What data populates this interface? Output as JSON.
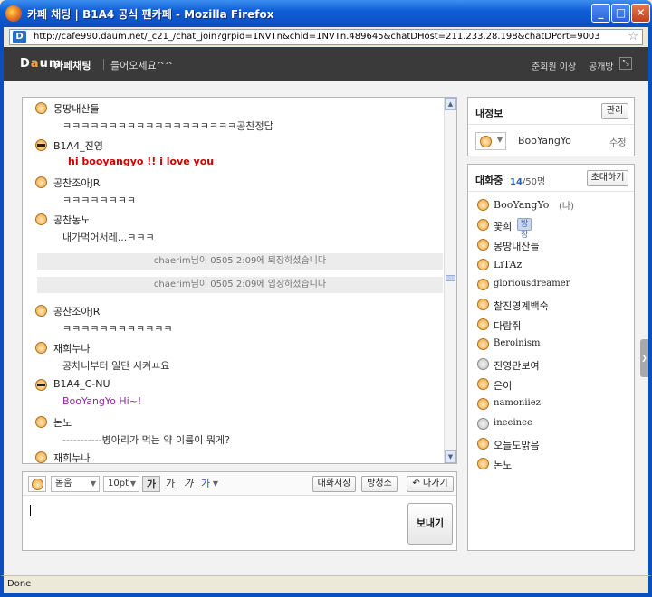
{
  "window": {
    "title": "카페 채팅 | B1A4 공식 팬카페 - Mozilla Firefox"
  },
  "address_bar": {
    "url": "http://cafe990.daum.net/_c21_/chat_join?grpid=1NVTn&chid=1NVTn.489645&chatDHost=211.233.28.198&chatDPort=9003"
  },
  "header": {
    "logo": "Daum",
    "service": "카페채팅",
    "welcome": "들어오세요^^",
    "level": "준회원 이상",
    "open_room": "공개방"
  },
  "chat": {
    "messages": [
      {
        "nick": "몽땅내산들",
        "text": "ㅋㅋㅋㅋㅋㅋㅋㅋㅋㅋㅋㅋㅋㅋㅋㅋㅋㅋㅋ공찬정답",
        "face": "normal",
        "color": "#333333"
      },
      {
        "nick": "B1A4_진영",
        "text": "hi booyangyo !! i love you",
        "face": "cool",
        "color": "#cc0000"
      },
      {
        "nick": "공찬조아JR",
        "text": "ㅋㅋㅋㅋㅋㅋㅋㅋ",
        "face": "normal",
        "color": "#333333"
      },
      {
        "nick": "공찬농노",
        "text": "내가먹어서레...ㅋㅋㅋ",
        "face": "normal",
        "color": "#333333"
      },
      {
        "nick": "공찬조아JR",
        "text": "ㅋㅋㅋㅋㅋㅋㅋㅋㅋㅋㅋㅋ",
        "face": "normal",
        "color": "#333333"
      },
      {
        "nick": "재희누나",
        "text": "공차니부터 일단 시켜ㅛ요",
        "face": "normal",
        "color": "#333333"
      },
      {
        "nick": "B1A4_C-NU",
        "text": "BooYangYo Hi~!",
        "face": "cool",
        "color": "#8a2a9a"
      },
      {
        "nick": "논노",
        "text": "-----------병아리가 먹는 약 이름이 뭐게?",
        "face": "normal",
        "color": "#333333"
      },
      {
        "nick": "재희누나",
        "text": "",
        "face": "normal",
        "color": "#333333"
      }
    ],
    "system": [
      "chaerim님이 0505 2:09에 퇴장하셨습니다",
      "chaerim님이 0505 2:09에 입장하셨습니다"
    ]
  },
  "composer": {
    "font": "돋움",
    "size": "10pt",
    "fmt_bold": "가",
    "fmt_underline": "가",
    "fmt_italic": "가",
    "fmt_color": "가",
    "save_label": "대화저장",
    "clear_label": "방청소",
    "exit_label": "나가기",
    "exit_icon": "↶",
    "send_label": "보내기",
    "input_value": ""
  },
  "profile": {
    "title": "내정보",
    "manage_label": "관리",
    "name": "BooYangYo",
    "edit_label": "수정"
  },
  "participants": {
    "title": "대화중",
    "count": "14",
    "max": "/50명",
    "invite_label": "초대하기",
    "users": [
      {
        "name": "BooYangYo",
        "tag": "(나)",
        "serif": true,
        "face": "normal"
      },
      {
        "name": "꽃희",
        "badge": "방장",
        "serif": false,
        "face": "normal"
      },
      {
        "name": "몽땅내산들",
        "serif": false,
        "face": "normal"
      },
      {
        "name": "LiTAz",
        "serif": true,
        "face": "normal"
      },
      {
        "name": "gloriousdreamer",
        "serif": true,
        "face": "normal"
      },
      {
        "name": "찰진영계백숙",
        "serif": false,
        "face": "normal"
      },
      {
        "name": "다람쥐",
        "serif": false,
        "face": "normal"
      },
      {
        "name": "Beroinism",
        "serif": true,
        "face": "normal"
      },
      {
        "name": "진영만보여",
        "serif": false,
        "face": "gray"
      },
      {
        "name": "은이",
        "serif": false,
        "face": "normal"
      },
      {
        "name": "namoniiez",
        "serif": true,
        "face": "normal"
      },
      {
        "name": "ineeinee",
        "serif": true,
        "face": "gray"
      },
      {
        "name": "오늘도맑음",
        "serif": false,
        "face": "normal"
      },
      {
        "name": "논노",
        "serif": false,
        "face": "normal"
      }
    ]
  },
  "status": {
    "text": "Done"
  }
}
